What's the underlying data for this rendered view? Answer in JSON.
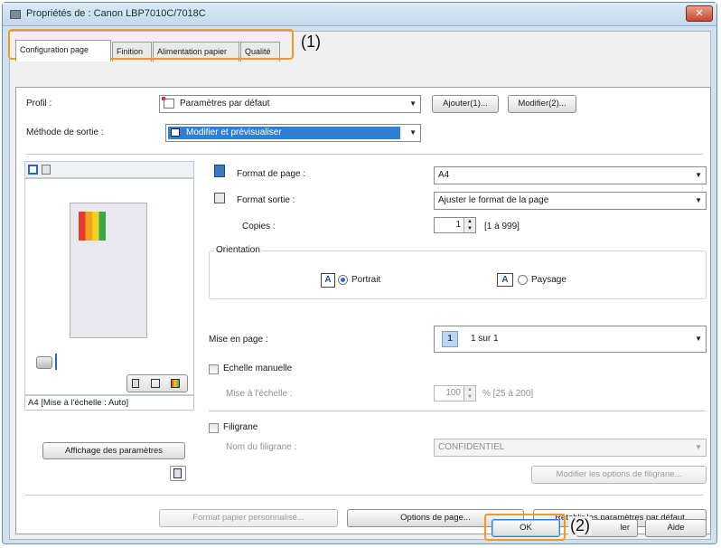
{
  "window": {
    "title": "Propriétés de : Canon LBP7010C/7018C",
    "close_label": "✕"
  },
  "tabs": [
    {
      "label": "Configuration page",
      "active": true
    },
    {
      "label": "Finition",
      "active": false
    },
    {
      "label": "Alimentation papier",
      "active": false
    },
    {
      "label": "Qualité",
      "active": false
    }
  ],
  "profile": {
    "label": "Profil :",
    "value": "Paramètres par défaut",
    "add_button": "Ajouter(1)...",
    "edit_button": "Modifier(2)..."
  },
  "output_method": {
    "label": "Méthode de sortie :",
    "value": "Modifier et prévisualiser"
  },
  "preview": {
    "status": "A4 [Mise à l'échelle : Auto]",
    "show_settings_button": "Affichage des paramètres"
  },
  "page_size": {
    "label": "Format de page :",
    "value": "A4"
  },
  "output_size": {
    "label": "Format sortie :",
    "value": "Ajuster le format de la page"
  },
  "copies": {
    "label": "Copies :",
    "value": "1",
    "range": "[1 à 999]"
  },
  "orientation": {
    "group_label": "Orientation",
    "portrait_label": "Portrait",
    "landscape_label": "Paysage",
    "selected": "Portrait",
    "icon_letter": "A"
  },
  "layout": {
    "label": "Mise en page :",
    "value": "1 sur 1",
    "icon_number": "1"
  },
  "manual_scaling": {
    "checkbox_label": "Echelle manuelle",
    "checked": false,
    "scale_label": "Mise à l'échelle :",
    "scale_value": "100",
    "scale_range": "% [25 à 200]"
  },
  "watermark": {
    "checkbox_label": "Filigrane",
    "checked": false,
    "name_label": "Nom du filigrane :",
    "name_value": "CONFIDENTIEL",
    "options_button": "Modifier les options de filigrane..."
  },
  "bottom_buttons": {
    "custom_paper": "Format papier personnalisé...",
    "page_options": "Options de page...",
    "restore_defaults": "Rétablir les paramètres par défaut"
  },
  "dialog_buttons": {
    "ok": "OK",
    "cancel": "ler",
    "help": "Aide"
  },
  "callouts": {
    "tabs": "(1)",
    "ok": "(2)"
  },
  "colors": {
    "highlight": "#f39a1e",
    "selection": "#2f7fd4",
    "titlebar": "#cfe1f1",
    "close": "#c9452b"
  }
}
